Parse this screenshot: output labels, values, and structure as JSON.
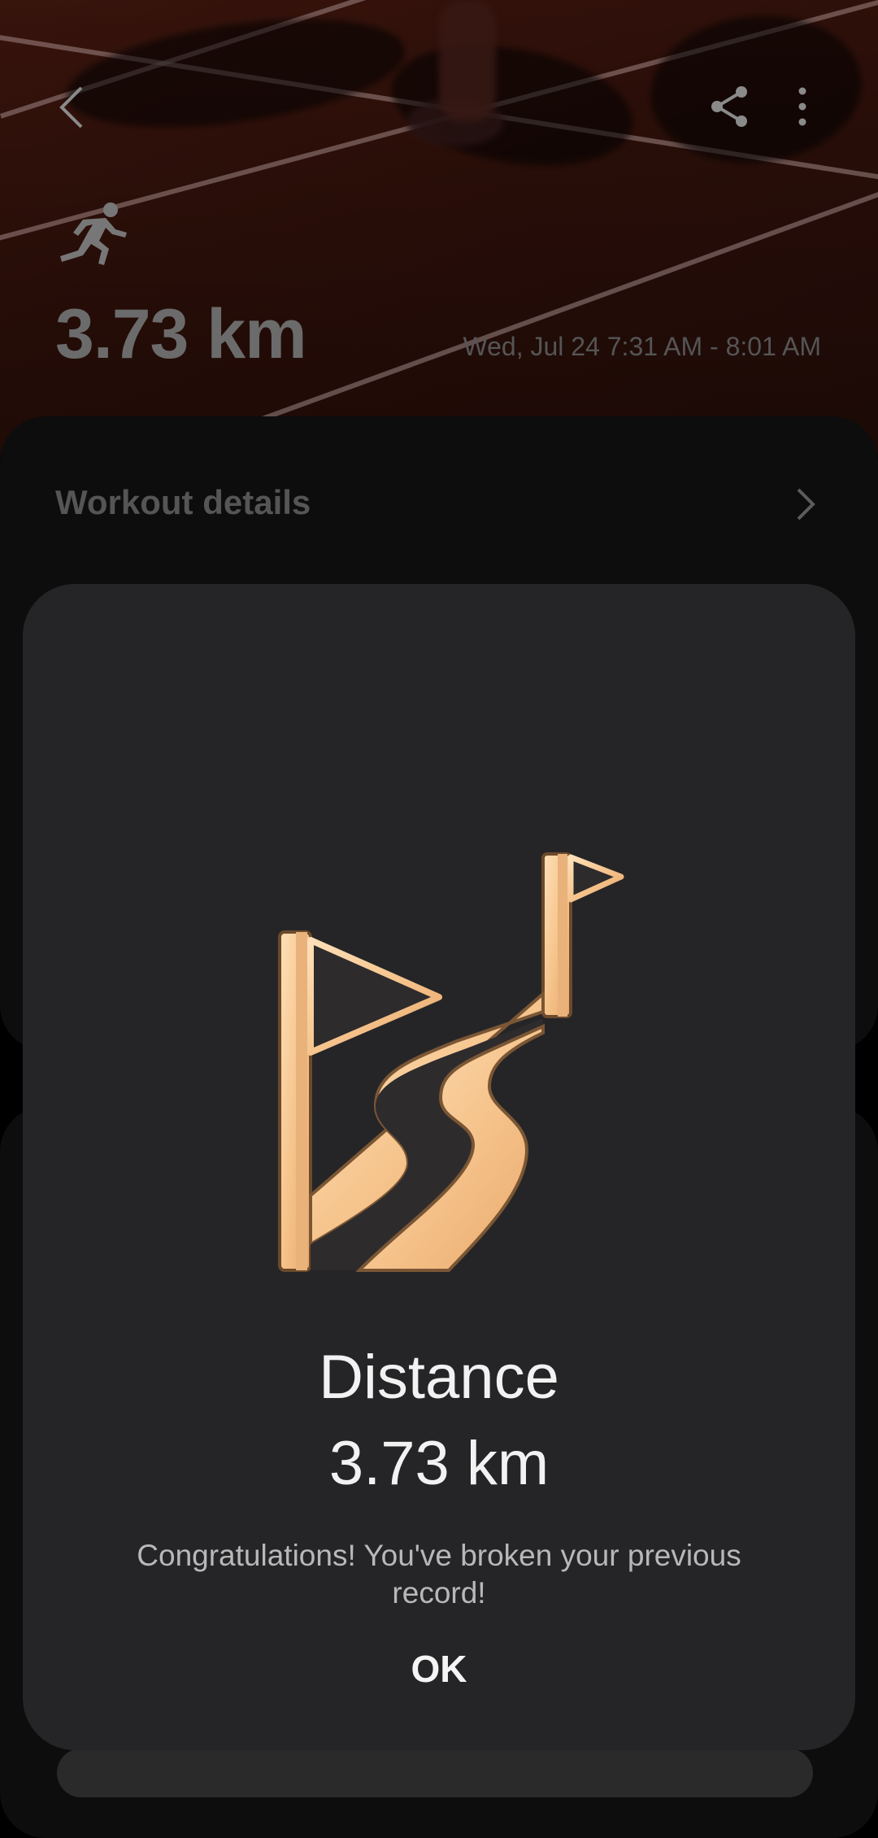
{
  "header": {
    "distance": "3.73 km",
    "date_range": "Wed, Jul 24 7:31 AM - 8:01 AM"
  },
  "sections": {
    "workout_details_label": "Workout details"
  },
  "dialog": {
    "title": "Distance",
    "value": "3.73 km",
    "message": "Congratulations! You've broken your previous record!",
    "ok_label": "OK"
  },
  "icons": {
    "back": "back-arrow-icon",
    "share": "share-icon",
    "more": "more-vert-icon",
    "activity": "running-icon",
    "badge": "road-flags-badge",
    "chevron": "chevron-right-icon"
  },
  "colors": {
    "badge_gold": "#f6c58e",
    "dialog_bg": "#252527",
    "track_red": "#4a1a10"
  }
}
